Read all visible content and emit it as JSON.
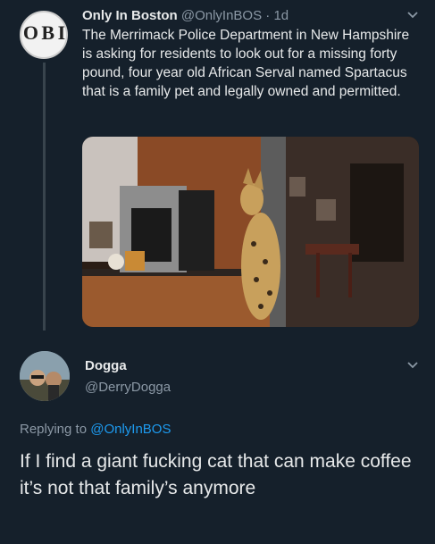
{
  "tweet1": {
    "display_name": "Only In Boston",
    "handle": "@OnlyInBOS",
    "separator": "·",
    "time": "1d",
    "avatar_logo": "O B I",
    "text": "The Merrimack Police Department in New Hampshire is asking for residents to look out for a missing forty pound, four year old African Serval named Spartacus that is a family pet and legally owned and permitted."
  },
  "tweet2": {
    "display_name": "Dogga",
    "handle": "@DerryDogga",
    "replying_prefix": "Replying to",
    "replying_to": "@OnlyInBOS",
    "text": "If I find a giant fucking cat that can make coffee it’s not that family’s anymore"
  },
  "icons": {
    "more": "chevron-down-icon"
  },
  "colors": {
    "background": "#15202b",
    "text": "#e7e9ea",
    "secondary": "#8b98a5",
    "link": "#1d9bf0"
  }
}
